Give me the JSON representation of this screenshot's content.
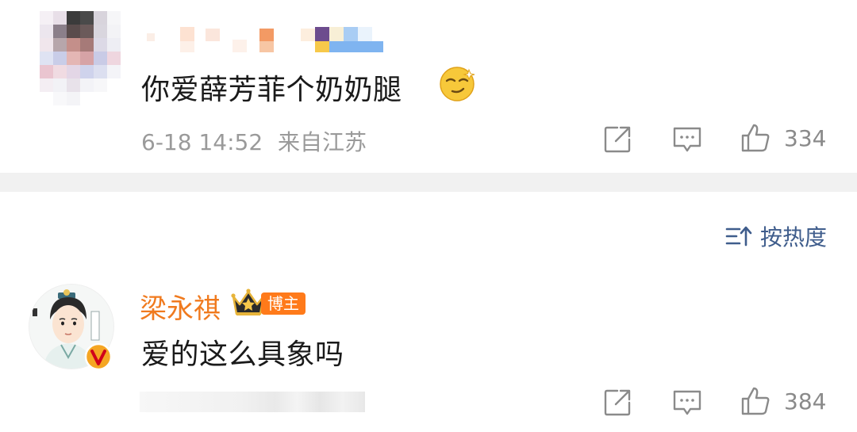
{
  "comment1": {
    "text": "你爱薛芳菲个奶奶腿",
    "emoji": "sly-smile-emoji",
    "time": "6-18 14:52",
    "location": "来自江苏",
    "likes": "334"
  },
  "sort": {
    "label": "按热度",
    "icon": "sort-icon"
  },
  "comment2": {
    "username": "梁永祺",
    "badge": "博主",
    "crown_icon": "crown-icon",
    "verified_icon": "verified-v-icon",
    "text": "爱的这么具象吗",
    "likes": "384"
  },
  "colors": {
    "text": "#1a1a1a",
    "meta": "#9a9a9a",
    "username": "#f07a1e",
    "badge_bg": "#ff7a1a",
    "sort_link": "#3f5d8c",
    "divider": "#f1f1f1"
  }
}
